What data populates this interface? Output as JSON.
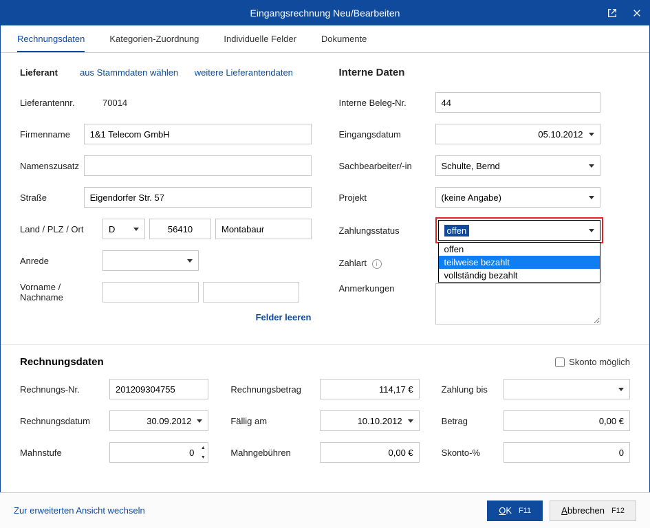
{
  "header": {
    "title": "Eingangsrechnung Neu/Bearbeiten"
  },
  "tabs": [
    {
      "label": "Rechnungsdaten"
    },
    {
      "label": "Kategorien-Zuordnung"
    },
    {
      "label": "Individuelle Felder"
    },
    {
      "label": "Dokumente"
    }
  ],
  "lieferant": {
    "title": "Lieferant",
    "link_stammdaten": "aus Stammdaten wählen",
    "link_weitere": "weitere Lieferantendaten",
    "lbl_nummer": "Lieferantennr.",
    "nummer": "70014",
    "lbl_firmenname": "Firmenname",
    "firmenname": "1&1 Telecom GmbH",
    "lbl_namenszusatz": "Namenszusatz",
    "namenszusatz": "",
    "lbl_strasse": "Straße",
    "strasse": "Eigendorfer Str. 57",
    "lbl_landplzort": "Land / PLZ / Ort",
    "land": "D",
    "plz": "56410",
    "ort": "Montabaur",
    "lbl_anrede": "Anrede",
    "anrede": "",
    "lbl_vornamenachname": "Vorname / Nachname",
    "vorname": "",
    "nachname": "",
    "felder_leeren": "Felder leeren"
  },
  "intern": {
    "title": "Interne Daten",
    "lbl_belegnr": "Interne Beleg-Nr.",
    "belegnr": "44",
    "lbl_eingangsdatum": "Eingangsdatum",
    "eingangsdatum": "05.10.2012",
    "lbl_sachbearbeiter": "Sachbearbeiter/-in",
    "sachbearbeiter": "Schulte, Bernd",
    "lbl_projekt": "Projekt",
    "projekt": "(keine Angabe)",
    "lbl_zahlungsstatus": "Zahlungsstatus",
    "zahlungsstatus_selected": "offen",
    "zahlungsstatus_options": [
      "offen",
      "teilweise bezahlt",
      "vollständig bezahlt"
    ],
    "lbl_zahlart": "Zahlart",
    "zahlart": "",
    "lbl_anmerkungen": "Anmerkungen",
    "anmerkungen": ""
  },
  "rechnungsdaten": {
    "title": "Rechnungsdaten",
    "skonto_label": "Skonto möglich",
    "lbl_rechnungsnr": "Rechnungs-Nr.",
    "rechnungsnr": "201209304755",
    "lbl_rechnungsdatum": "Rechnungsdatum",
    "rechnungsdatum": "30.09.2012",
    "lbl_mahnstufe": "Mahnstufe",
    "mahnstufe": "0",
    "lbl_rechnungsbetrag": "Rechnungsbetrag",
    "rechnungsbetrag": "114,17 €",
    "lbl_faelligam": "Fällig am",
    "faelligam": "10.10.2012",
    "lbl_mahngebuehren": "Mahngebühren",
    "mahngebuehren": "0,00 €",
    "lbl_zahlungbis": "Zahlung bis",
    "zahlungbis": "",
    "lbl_betrag": "Betrag",
    "betrag": "0,00 €",
    "lbl_skontopct": "Skonto-%",
    "skontopct": "0"
  },
  "footer": {
    "advanced_link": "Zur erweiterten Ansicht wechseln",
    "ok_label_underline": "O",
    "ok_label_rest": "K",
    "ok_shortcut": "F11",
    "cancel_label_underline": "A",
    "cancel_label_rest": "bbrechen",
    "cancel_shortcut": "F12"
  }
}
